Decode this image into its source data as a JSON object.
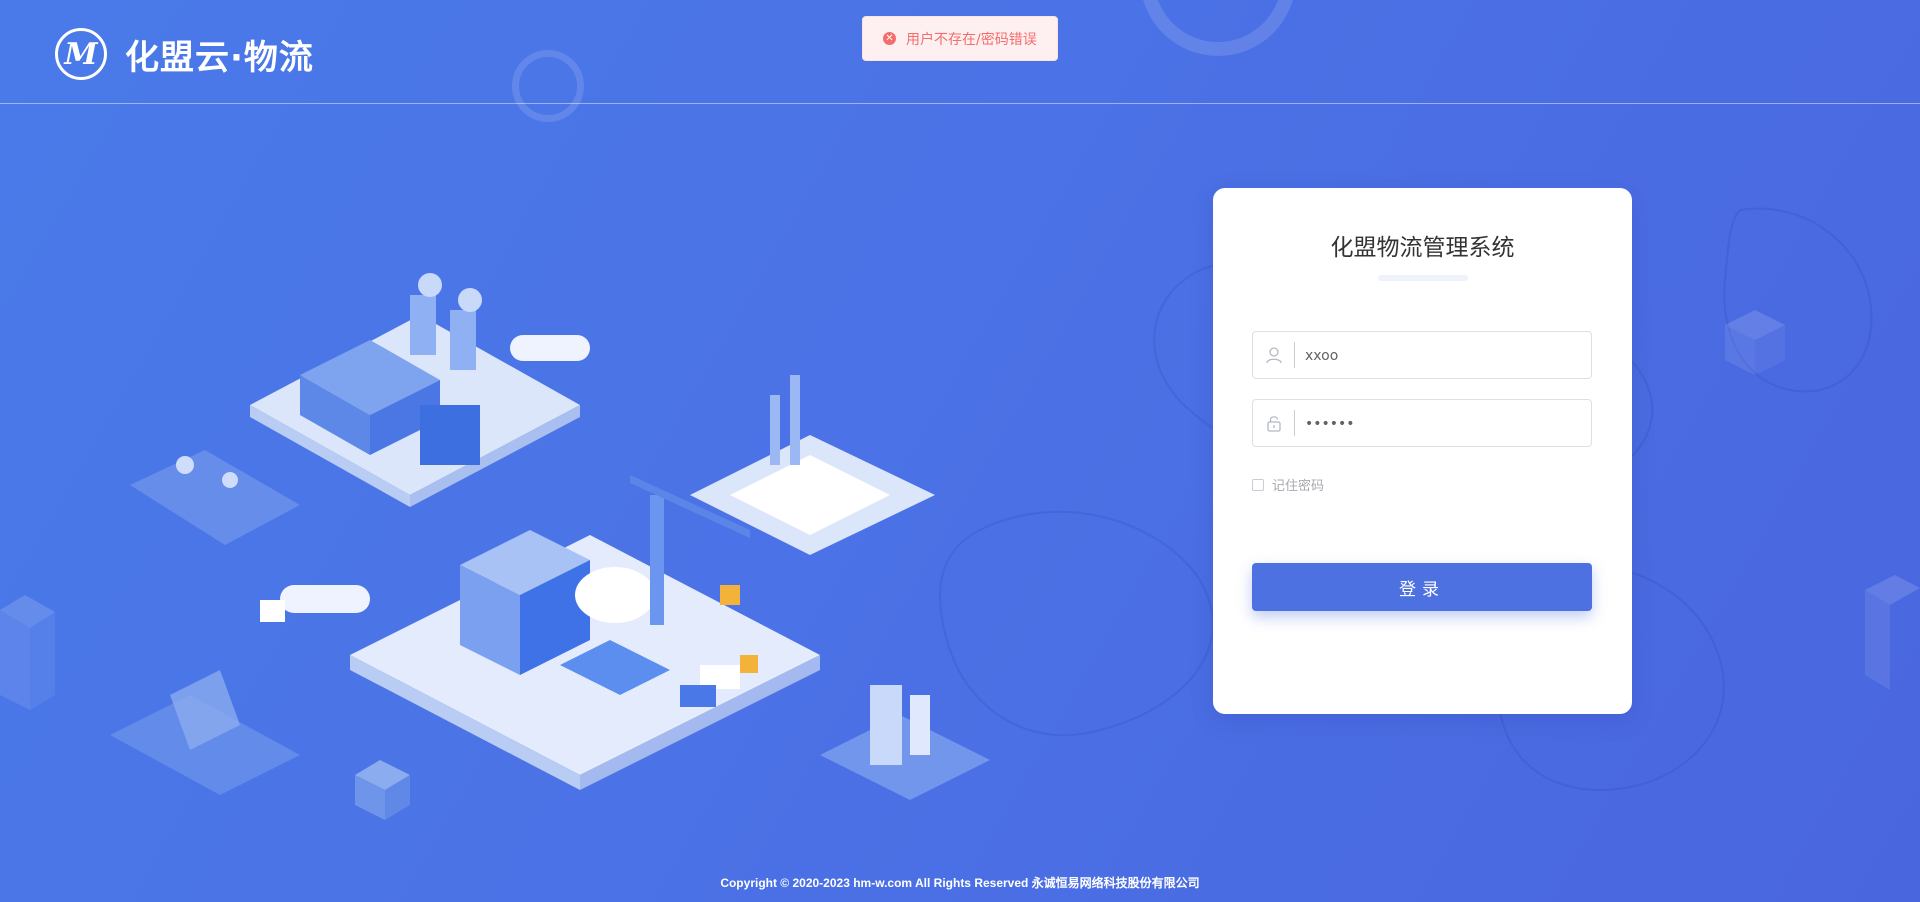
{
  "brand": {
    "logo_letter": "M",
    "name": "化盟云·物流"
  },
  "toast": {
    "icon": "error-circle-icon",
    "message": "用户不存在/密码错误",
    "color": "#f56c6c"
  },
  "login": {
    "title": "化盟物流管理系统",
    "username": {
      "value": "xxoo",
      "icon": "user-icon"
    },
    "password": {
      "value": "123456",
      "icon": "lock-icon"
    },
    "remember_label": "记住密码",
    "remember_checked": false,
    "submit_label": "登录"
  },
  "footer": {
    "copyright": "Copyright © 2020-2023 hm-w.com All Rights Reserved 永诚恒易网络科技股份有限公司"
  },
  "colors": {
    "background": "#4a72e6",
    "accent": "#4e71e1",
    "card": "#ffffff"
  }
}
